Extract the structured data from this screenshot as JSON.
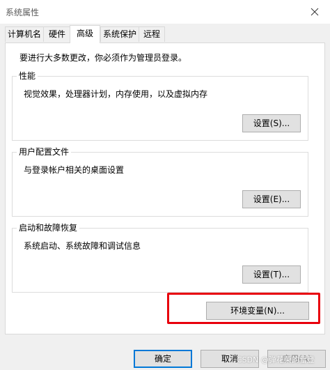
{
  "window": {
    "title": "系统属性"
  },
  "tabs": [
    {
      "label": "计算机名"
    },
    {
      "label": "硬件"
    },
    {
      "label": "高级"
    },
    {
      "label": "系统保护"
    },
    {
      "label": "远程"
    }
  ],
  "active_tab": "高级",
  "intro_text": "要进行大多数更改，你必须作为管理员登录。",
  "groups": {
    "performance": {
      "label": "性能",
      "desc": "视觉效果，处理器计划，内存使用，以及虚拟内存",
      "button": "设置(S)..."
    },
    "user_profiles": {
      "label": "用户配置文件",
      "desc": "与登录帐户相关的桌面设置",
      "button": "设置(E)..."
    },
    "startup_recovery": {
      "label": "启动和故障恢复",
      "desc": "系统启动、系统故障和调试信息",
      "button": "设置(T)..."
    }
  },
  "env_button": "环境变量(N)...",
  "footer": {
    "ok": "确定",
    "cancel": "取消",
    "apply": "应用(A)"
  },
  "watermark": "CSDN @弹花荣的雷登",
  "colors": {
    "highlight": "#e8000c",
    "accent": "#0078d7"
  },
  "icons": {
    "close": "close-icon"
  }
}
